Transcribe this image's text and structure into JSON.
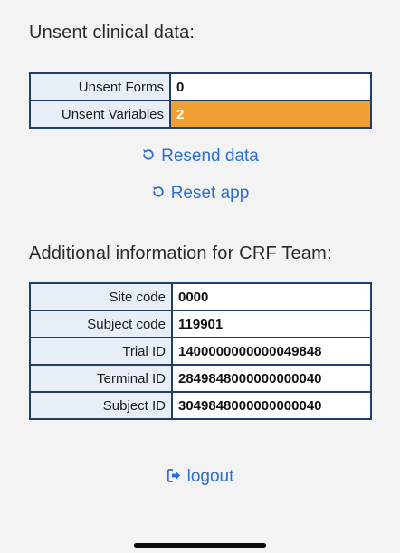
{
  "unsent": {
    "title": "Unsent clinical data:",
    "rows": [
      {
        "label": "Unsent Forms",
        "value": "0"
      },
      {
        "label": "Unsent Variables",
        "value": "2"
      }
    ],
    "warning_color": "#f0a032"
  },
  "actions": {
    "resend_label": "Resend data",
    "reset_label": "Reset app",
    "resend_icon": "refresh-icon",
    "reset_icon": "refresh-icon"
  },
  "crf": {
    "title": "Additional information for CRF Team:",
    "rows": [
      {
        "label": "Site code",
        "value": "0000"
      },
      {
        "label": "Subject code",
        "value": "119901"
      },
      {
        "label": "Trial ID",
        "value": "1400000000000049848"
      },
      {
        "label": "Terminal ID",
        "value": "2849848000000000040"
      },
      {
        "label": "Subject ID",
        "value": "3049848000000000040"
      }
    ]
  },
  "footer": {
    "logout_label": "logout",
    "logout_icon": "sign-out-icon"
  },
  "colors": {
    "link": "#2d6fd1",
    "table_border": "#1f3f66",
    "label_cell_bg": "#e7eef8"
  }
}
